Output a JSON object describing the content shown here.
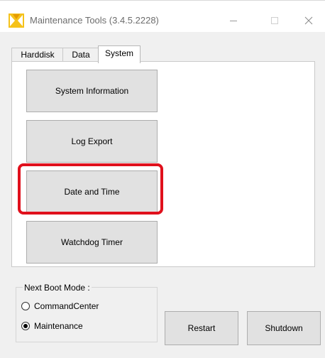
{
  "window": {
    "title": "Maintenance Tools (3.4.5.2228)",
    "controls": {
      "minimize": "—",
      "maximize": "☐",
      "close": "✕"
    }
  },
  "tabs": [
    {
      "label": "Harddisk"
    },
    {
      "label": "Data"
    },
    {
      "label": "System",
      "selected": true
    }
  ],
  "system_panel": {
    "buttons": [
      {
        "label": "System Information"
      },
      {
        "label": "Log Export"
      },
      {
        "label": "Date and Time",
        "highlighted": true
      },
      {
        "label": "Watchdog Timer"
      }
    ]
  },
  "boot_mode": {
    "label": "Next Boot Mode :",
    "options": [
      {
        "label": "CommandCenter",
        "checked": false
      },
      {
        "label": "Maintenance",
        "checked": true
      }
    ]
  },
  "actions": {
    "restart": "Restart",
    "shutdown": "Shutdown"
  },
  "colors": {
    "highlight": "#e0101c",
    "icon_yellow": "#f5c21b"
  }
}
